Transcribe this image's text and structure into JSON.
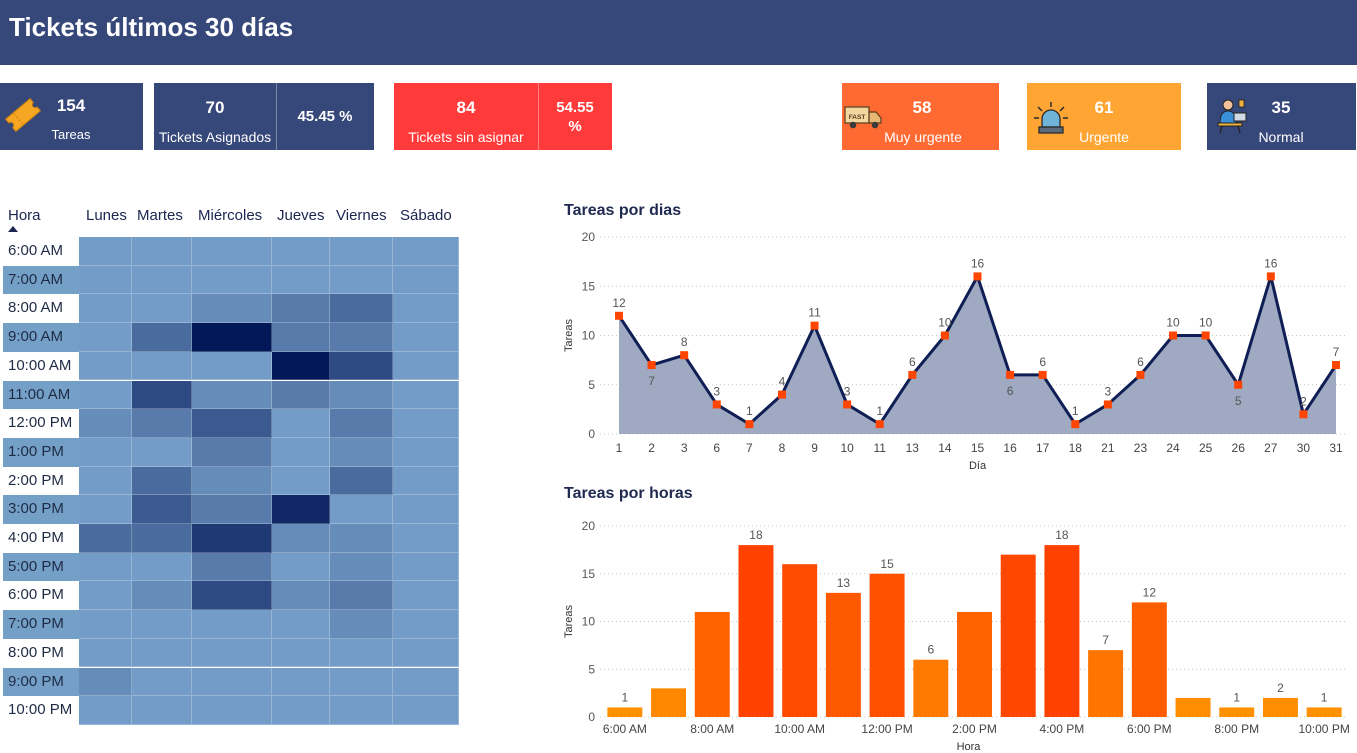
{
  "header": {
    "title": "Tickets últimos 30 días"
  },
  "cards": {
    "tareas": {
      "value": "154",
      "label": "Tareas",
      "icon": "ticket-icon"
    },
    "asignados": {
      "value": "70",
      "label": "Tickets Asignados",
      "pct": "45.45 %"
    },
    "sin_asignar": {
      "value": "84",
      "label": "Tickets sin asignar",
      "pct_line1": "54.55",
      "pct_line2": "%"
    },
    "muy_urgente": {
      "value": "58",
      "label": "Muy urgente",
      "icon": "fast-delivery-truck-icon",
      "icon_text": "FAST"
    },
    "urgente": {
      "value": "61",
      "label": "Urgente",
      "icon": "siren-alarm-icon"
    },
    "normal": {
      "value": "35",
      "label": "Normal",
      "icon": "person-at-desk-icon"
    }
  },
  "colors": {
    "header": "#36477a",
    "card_navy": "#36477a",
    "card_red": "#ff3a3a",
    "card_orange_dark": "#ff6a33",
    "card_orange_light": "#ffa533",
    "line": "#0f1f55",
    "area": "#9fa9c2",
    "marker": "#ff4500"
  },
  "heatmap": {
    "corner_label": "Hora",
    "days": [
      "Lunes",
      "Martes",
      "Miércoles",
      "Jueves",
      "Viernes",
      "Sábado"
    ],
    "hours": [
      "6:00 AM",
      "7:00 AM",
      "8:00 AM",
      "9:00 AM",
      "10:00 AM",
      "11:00 AM",
      "12:00 PM",
      "1:00 PM",
      "2:00 PM",
      "3:00 PM",
      "4:00 PM",
      "5:00 PM",
      "6:00 PM",
      "7:00 PM",
      "8:00 PM",
      "9:00 PM",
      "10:00 PM"
    ],
    "values": [
      [
        0,
        0,
        0,
        0,
        0,
        0
      ],
      [
        0,
        0,
        0,
        0,
        0,
        0
      ],
      [
        0,
        0,
        1,
        2,
        3,
        0
      ],
      [
        0,
        3,
        8,
        2,
        2,
        0
      ],
      [
        0,
        0,
        0,
        8,
        5,
        0
      ],
      [
        0,
        5,
        1,
        2,
        1,
        0
      ],
      [
        1,
        2,
        4,
        0,
        2,
        0
      ],
      [
        0,
        0,
        2,
        0,
        1,
        0
      ],
      [
        0,
        3,
        1,
        0,
        3,
        0
      ],
      [
        0,
        4,
        2,
        7,
        0,
        0
      ],
      [
        3,
        3,
        6,
        1,
        1,
        0
      ],
      [
        0,
        0,
        2,
        0,
        1,
        0
      ],
      [
        0,
        1,
        5,
        1,
        2,
        0
      ],
      [
        0,
        0,
        0,
        0,
        1,
        0
      ],
      [
        0,
        0,
        0,
        0,
        0,
        0
      ],
      [
        1,
        0,
        0,
        0,
        0,
        0
      ],
      [
        0,
        0,
        0,
        0,
        0,
        0
      ]
    ]
  },
  "chart_data": [
    {
      "type": "area",
      "title": "Tareas por dias",
      "xlabel": "Día",
      "ylabel": "Tareas",
      "ylim": [
        0,
        20
      ],
      "yticks": [
        0,
        5,
        10,
        15,
        20
      ],
      "grid": true,
      "categories": [
        "1",
        "2",
        "3",
        "6",
        "7",
        "8",
        "9",
        "10",
        "11",
        "13",
        "14",
        "15",
        "16",
        "17",
        "18",
        "21",
        "23",
        "24",
        "25",
        "26",
        "27",
        "30",
        "31"
      ],
      "values": [
        12,
        7,
        8,
        3,
        1,
        4,
        11,
        3,
        1,
        6,
        10,
        16,
        6,
        6,
        1,
        3,
        6,
        10,
        10,
        5,
        16,
        2,
        7
      ],
      "label_below": [
        false,
        true,
        false,
        false,
        false,
        false,
        false,
        false,
        false,
        false,
        false,
        false,
        true,
        false,
        false,
        false,
        false,
        false,
        false,
        true,
        false,
        false,
        false
      ]
    },
    {
      "type": "bar",
      "title": "Tareas por horas",
      "xlabel": "Hora",
      "ylabel": "Tareas",
      "ylim": [
        0,
        20
      ],
      "yticks": [
        0,
        5,
        10,
        15,
        20
      ],
      "grid": true,
      "categories": [
        "6:00 AM",
        "7:00 AM",
        "8:00 AM",
        "9:00 AM",
        "10:00 AM",
        "11:00 AM",
        "12:00 PM",
        "1:00 PM",
        "2:00 PM",
        "3:00 PM",
        "4:00 PM",
        "5:00 PM",
        "6:00 PM",
        "7:00 PM",
        "8:00 PM",
        "9:00 PM",
        "10:00 PM"
      ],
      "values": [
        1,
        3,
        11,
        18,
        16,
        13,
        15,
        6,
        11,
        17,
        18,
        7,
        12,
        2,
        1,
        2,
        1
      ],
      "shown_labels": [
        true,
        false,
        false,
        true,
        false,
        true,
        true,
        true,
        false,
        false,
        true,
        true,
        true,
        false,
        true,
        true,
        true
      ],
      "x_tick_labels": [
        "6:00 AM",
        "",
        "8:00 AM",
        "",
        "10:00 AM",
        "",
        "12:00 PM",
        "",
        "2:00 PM",
        "",
        "4:00 PM",
        "",
        "6:00 PM",
        "",
        "8:00 PM",
        "",
        "10:00 PM"
      ]
    }
  ]
}
